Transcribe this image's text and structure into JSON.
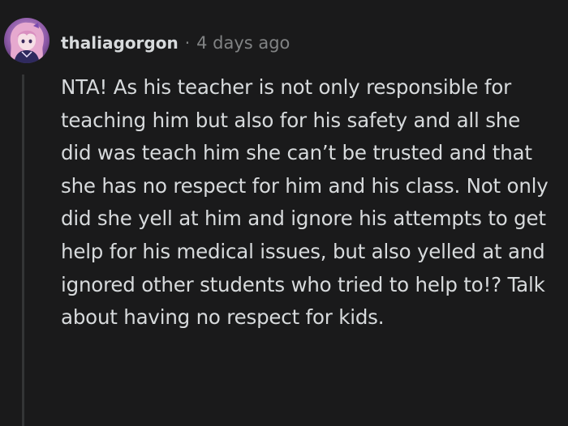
{
  "comment": {
    "author": "thaliagorgon",
    "separator": "·",
    "timestamp": "4 days ago",
    "avatar_icon": "user-avatar",
    "body": "NTA! As his teacher is not only responsible for teaching him but also for his safety and all she did was teach him she can’t be trusted and that she has no respect for him and his class. Not only did she yell at him and ignore his attempts to get help for his medical issues, but also yelled at and ignored other students who tried to help to!? Talk about having no respect for kids."
  },
  "colors": {
    "background": "#1a1a1b",
    "text": "#d7dadc",
    "meta": "#818384",
    "thread_line": "#343536"
  }
}
